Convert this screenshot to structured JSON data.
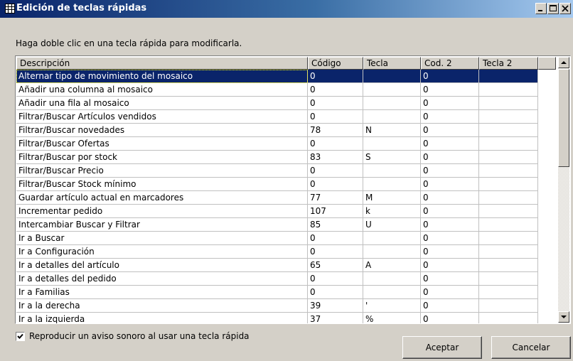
{
  "window": {
    "title": "Edición de teclas rápidas",
    "icon": "grid-icon",
    "controls": [
      "minimize-icon",
      "maximize-icon",
      "close-icon"
    ]
  },
  "instruction": "Haga doble clic en una tecla rápida para modificarla.",
  "table": {
    "columns": [
      "Descripción",
      "Código",
      "Tecla",
      "Cod. 2",
      "Tecla 2"
    ],
    "selected_row": 0,
    "rows": [
      [
        "Alternar tipo de movimiento del mosaico",
        "0",
        "",
        "0",
        ""
      ],
      [
        "Añadir una columna al mosaico",
        "0",
        "",
        "0",
        ""
      ],
      [
        "Añadir una fila al mosaico",
        "0",
        "",
        "0",
        ""
      ],
      [
        "Filtrar/Buscar Artículos vendidos",
        "0",
        "",
        "0",
        ""
      ],
      [
        "Filtrar/Buscar novedades",
        "78",
        "N",
        "0",
        ""
      ],
      [
        "Filtrar/Buscar Ofertas",
        "0",
        "",
        "0",
        ""
      ],
      [
        "Filtrar/Buscar por stock",
        "83",
        "S",
        "0",
        ""
      ],
      [
        "Filtrar/Buscar Precio",
        "0",
        "",
        "0",
        ""
      ],
      [
        "Filtrar/Buscar Stock mínimo",
        "0",
        "",
        "0",
        ""
      ],
      [
        "Guardar artículo actual en marcadores",
        "77",
        "M",
        "0",
        ""
      ],
      [
        "Incrementar pedido",
        "107",
        "k",
        "0",
        ""
      ],
      [
        "Intercambiar Buscar y Filtrar",
        "85",
        "U",
        "0",
        ""
      ],
      [
        "Ir a Buscar",
        "0",
        "",
        "0",
        ""
      ],
      [
        "Ir a Configuración",
        "0",
        "",
        "0",
        ""
      ],
      [
        "Ir a detalles del artículo",
        "65",
        "A",
        "0",
        ""
      ],
      [
        "Ir a detalles del pedido",
        "0",
        "",
        "0",
        ""
      ],
      [
        "Ir a Familias",
        "0",
        "",
        "0",
        ""
      ],
      [
        "Ir a la derecha",
        "39",
        "'",
        "0",
        ""
      ],
      [
        "Ir a la izquierda",
        "37",
        "%",
        "0",
        ""
      ]
    ]
  },
  "sound_checkbox": {
    "label": "Reproducir un aviso sonoro al usar una tecla rápida",
    "checked": true
  },
  "buttons": {
    "accept": "Aceptar",
    "cancel": "Cancelar"
  },
  "colors": {
    "title_gradient_start": "#0a246a",
    "title_gradient_end": "#a6caf0",
    "selection": "#0a246a",
    "window_face": "#d4d0c8"
  }
}
